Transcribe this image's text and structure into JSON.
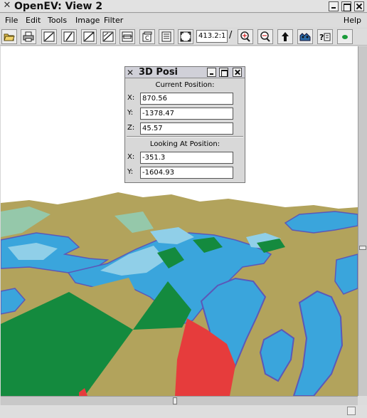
{
  "window": {
    "title": "OpenEV: View 2"
  },
  "menu": {
    "items": [
      "File",
      "Edit",
      "Tools",
      "Image",
      "Filter"
    ],
    "help": "Help"
  },
  "toolbar": {
    "buttons": [
      "open-folder-icon",
      "print-icon",
      "draw-line-icon",
      "draw-line-icon",
      "draw-line-icon",
      "draw-line-icon",
      "draw-region-icon",
      "copy-icon",
      "list-icon",
      "fit-icon"
    ],
    "zoom_value": "413.2:1",
    "right_buttons": [
      "zoom-in-icon",
      "zoom-out-icon",
      "up-arrow-icon",
      "layers-icon",
      "help-query-icon",
      "eye-icon"
    ]
  },
  "dialog": {
    "title": "3D Posi",
    "current": {
      "heading": "Current Position:",
      "x_label": "X:",
      "x": "870.56",
      "y_label": "Y:",
      "y": "-1378.47",
      "z_label": "Z:",
      "z": "45.57"
    },
    "looking": {
      "heading": "Looking At Position:",
      "x_label": "X:",
      "x": "-351.3",
      "y_label": "Y:",
      "y": "-1604.93"
    }
  },
  "colors": {
    "terrain_khaki": "#b2a35c",
    "water_blue": "#3aa5dc",
    "water_light": "#90cfe8",
    "outline_purple": "#5b58b8",
    "forest_green": "#148a3e",
    "urban_red": "#e63c3c",
    "pale_teal": "#95c8aa"
  }
}
